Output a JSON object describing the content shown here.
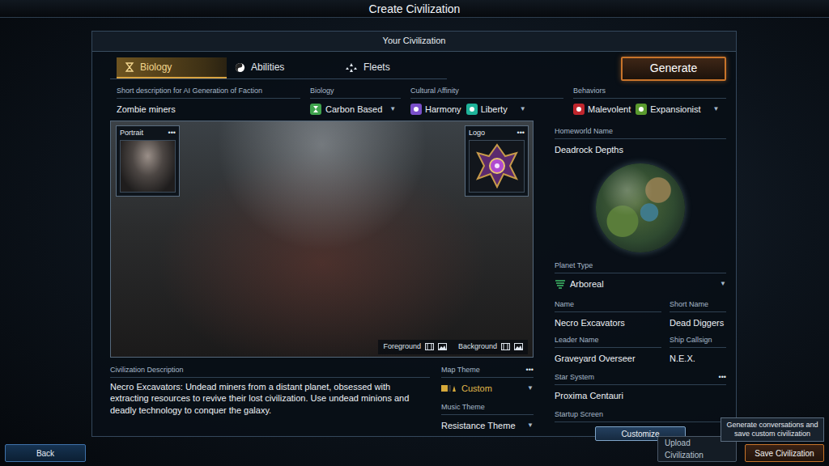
{
  "screen": {
    "title": "Create Civilization"
  },
  "panel": {
    "title": "Your Civilization"
  },
  "tabs": [
    {
      "label": "Biology",
      "selected": true
    },
    {
      "label": "Abilities",
      "selected": false
    },
    {
      "label": "Fleets",
      "selected": false
    }
  ],
  "generate_button": "Generate",
  "short_description": {
    "label": "Short description for AI Generation of Faction",
    "value": "Zombie miners"
  },
  "biology": {
    "label": "Biology",
    "value": "Carbon Based",
    "arrow": "▼"
  },
  "cultural_affinity": {
    "label": "Cultural Affinity",
    "arrow": "▼",
    "items": [
      {
        "name": "Harmony",
        "color": "#7a4fc9"
      },
      {
        "name": "Liberty",
        "color": "#1fb39a"
      }
    ]
  },
  "behaviors": {
    "label": "Behaviors",
    "arrow": "▼",
    "items": [
      {
        "name": "Malevolent",
        "color": "#c0262d"
      },
      {
        "name": "Expansionist",
        "color": "#5a9a2e"
      }
    ]
  },
  "art": {
    "portrait": {
      "label": "Portrait",
      "menu": "•••"
    },
    "logo": {
      "label": "Logo",
      "menu": "•••"
    },
    "layers": [
      "Foreground",
      "Background"
    ]
  },
  "homeworld": {
    "label": "Homeworld Name",
    "value": "Deadrock Depths"
  },
  "planet_type": {
    "label": "Planet Type",
    "value": "Arboreal",
    "arrow": "▼"
  },
  "identity": [
    {
      "label": "Name",
      "value": "Necro Excavators"
    },
    {
      "label": "Short Name",
      "value": "Dead Diggers"
    },
    {
      "label": "Leader Name",
      "value": "Graveyard Overseer"
    },
    {
      "label": "Ship Callsign",
      "value": "N.E.X."
    }
  ],
  "star_system": {
    "label": "Star System",
    "menu": "•••",
    "value": "Proxima Centauri"
  },
  "startup_screen": {
    "label": "Startup Screen",
    "button": "Customize"
  },
  "description": {
    "label": "Civilization Description",
    "value": "Necro Excavators: Undead miners from a distant planet, obsessed with extracting resources to revive their lost civilization. Use undead minions and deadly technology to conquer the galaxy."
  },
  "map_theme": {
    "label": "Map Theme",
    "menu": "•••",
    "value": "Custom",
    "arrow": "▼"
  },
  "music_theme": {
    "label": "Music Theme",
    "value": "Resistance Theme",
    "arrow": "▼"
  },
  "footer": {
    "back": "Back",
    "upload": "Upload Civilization",
    "save": "Save Civilization",
    "tooltip": "Generate conversations and save custom civilization"
  }
}
